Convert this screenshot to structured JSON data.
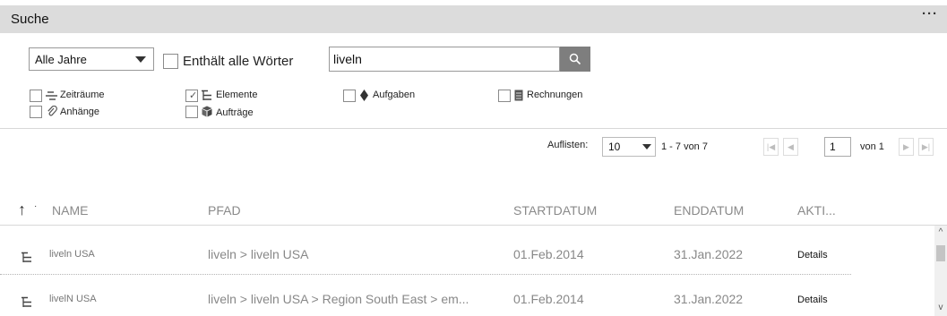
{
  "panel": {
    "title": "Suche",
    "more": "···"
  },
  "filters": {
    "year": "Alle Jahre",
    "all_words": "Enthält alle Wörter",
    "search": {
      "value": "liveln"
    },
    "types": [
      {
        "label": "Zeiträume",
        "checked": false
      },
      {
        "label": "Elemente",
        "checked": true
      },
      {
        "label": "Aufgaben",
        "checked": false
      },
      {
        "label": "Rechnungen",
        "checked": false
      },
      {
        "label": "Anhänge",
        "checked": false
      },
      {
        "label": "Aufträge",
        "checked": false
      }
    ]
  },
  "pager": {
    "list_label": "Auflisten:",
    "page_size": "10",
    "range": "1 - 7 von 7",
    "page": "1",
    "of": "von 1"
  },
  "table": {
    "columns": [
      "NAME",
      "PFAD",
      "STARTDATUM",
      "ENDDATUM",
      "AKTI..."
    ],
    "rows": [
      {
        "name": "liveln USA",
        "path": "liveln > liveln USA",
        "start": "01.Feb.2014",
        "end": "31.Jan.2022",
        "action": "Details"
      },
      {
        "name": "livelN USA",
        "path": "liveln > liveln USA > Region South East > em...",
        "start": "01.Feb.2014",
        "end": "31.Jan.2022",
        "action": "Details"
      }
    ]
  },
  "icons": {
    "search": "magnifier-icon",
    "periods": "timeline-icon",
    "elements": "hierarchy-icon",
    "tasks": "diamond-icon",
    "invoices": "invoice-icon",
    "attachments": "paperclip-icon",
    "orders": "box-icon"
  },
  "colors": {
    "header_bg": "#dcdcdc",
    "search_button": "#7e7e7e"
  }
}
